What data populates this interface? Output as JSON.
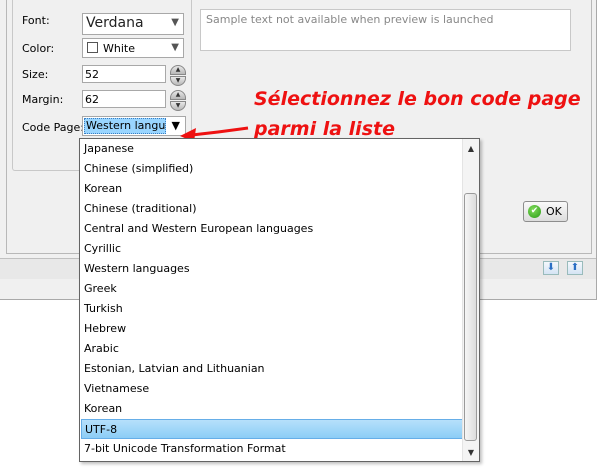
{
  "form": {
    "font_label": "Font:",
    "font_value": "Verdana",
    "color_label": "Color:",
    "color_value": "White",
    "size_label": "Size:",
    "size_value": "52",
    "margin_label": "Margin:",
    "margin_value": "62",
    "codepage_label": "Code Page:",
    "codepage_value": "Western languag"
  },
  "preview": {
    "text": "Sample text not available when preview is launched"
  },
  "annotation": {
    "line1": "Sélectionnez le bon code page",
    "line2": "parmi la liste",
    "color": "#ee1111"
  },
  "ok_button": {
    "label": "OK"
  },
  "dropdown": {
    "items": [
      "Japanese",
      "Chinese (simplified)",
      "Korean",
      "Chinese (traditional)",
      "Central and Western European languages",
      "Cyrillic",
      "Western languages",
      "Greek",
      "Turkish",
      "Hebrew",
      "Arabic",
      "Estonian, Latvian and Lithuanian",
      "Vietnamese",
      "Korean",
      "UTF-8",
      "7-bit Unicode Transformation Format"
    ],
    "selected_index": 14,
    "selection_color": "#99d5ff"
  }
}
